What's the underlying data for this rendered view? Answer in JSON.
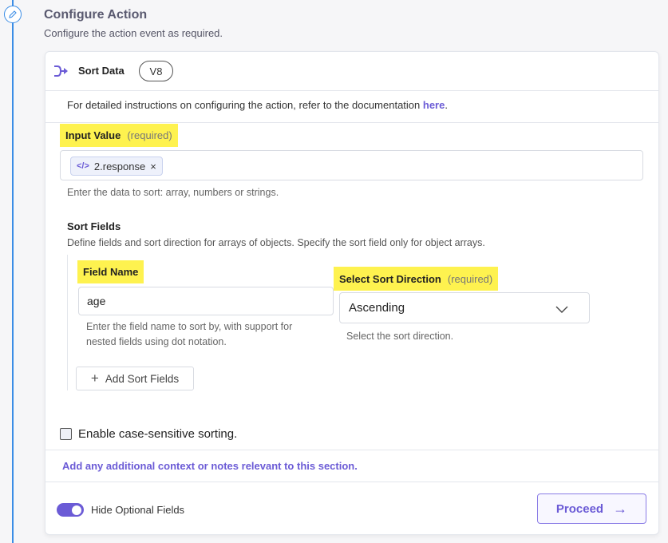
{
  "step": {
    "title": "Configure Action",
    "subtitle": "Configure the action event as required.",
    "icon": "pencil-icon"
  },
  "header": {
    "app_name": "Sort Data",
    "version": "V8",
    "icon": "sort-merge-icon"
  },
  "doc": {
    "text": "For detailed instructions on configuring the action, refer to the documentation ",
    "link": "here",
    "suffix": "."
  },
  "input_value": {
    "label": "Input Value",
    "required": "(required)",
    "chip": "2.response",
    "chip_icon": "code-icon",
    "help": "Enter the data to sort: array, numbers or strings."
  },
  "sort_fields": {
    "title": "Sort Fields",
    "description": "Define fields and sort direction for arrays of objects. Specify the sort field only for object arrays.",
    "field_name": {
      "label": "Field Name",
      "value": "age",
      "help1": "Enter the field name to sort by, with support for",
      "help2": "nested fields using dot notation."
    },
    "direction": {
      "label": "Select Sort Direction",
      "required": "(required)",
      "value": "Ascending",
      "help": "Select the sort direction."
    },
    "add_button": "Add Sort Fields"
  },
  "case_sensitive": {
    "label": "Enable case-sensitive sorting.",
    "checked": false
  },
  "notes_link": "Add any additional context or notes relevant to this section.",
  "footer": {
    "toggle_label": "Hide Optional Fields",
    "toggle_on": true,
    "proceed": "Proceed"
  },
  "colors": {
    "accent": "#6b5bd6",
    "highlight": "#fef24f",
    "timeline": "#3b8de6"
  }
}
